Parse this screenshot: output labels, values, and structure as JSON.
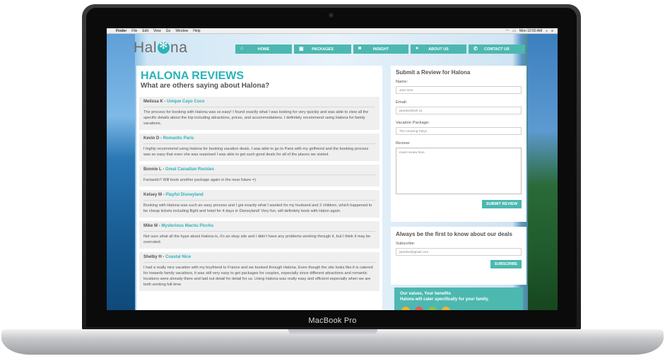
{
  "device": {
    "model_label": "MacBook Pro"
  },
  "menubar": {
    "apple": "",
    "items": [
      "Finder",
      "File",
      "Edit",
      "View",
      "Go",
      "Window",
      "Help"
    ],
    "clock": "Mon 10:50 AM"
  },
  "site": {
    "logo": {
      "left": "Hal",
      "right": "na"
    },
    "nav": [
      {
        "label": "HOME",
        "icon": "home-icon",
        "glyph": "⌂"
      },
      {
        "label": "PACKAGES",
        "icon": "suitcase-icon",
        "glyph": "▣"
      },
      {
        "label": "INSIGHT",
        "icon": "camera-icon",
        "glyph": "◙"
      },
      {
        "label": "ABOUT US",
        "icon": "person-icon",
        "glyph": "●"
      },
      {
        "label": "CONTACT US",
        "icon": "phone-icon",
        "glyph": "✆"
      }
    ]
  },
  "reviews": {
    "title": "HALONA REVIEWS",
    "subtitle": "What are others saying about Halona?",
    "items": [
      {
        "author": "Melissa K",
        "package": "Unique Cayo Coco",
        "text": "The process for booking with Halona was so easy! I found exactly what I was looking for very quickly and was able to view all the specific details about the trip including attractions, prices, and accommodations. I definitely recommend using Halona for family vacations."
      },
      {
        "author": "Kevin D",
        "package": "Romantic Paris",
        "text": "I highly recommend using Halona for booking vacation deals. I was able to go to Paris with my girlfriend and the booking process was so easy that even she was surprised I was able to get such good deals for all of the places we visited."
      },
      {
        "author": "Bonnie L",
        "package": "Great Canadian Rockies",
        "text": "Fantastic!! Will book another package again in the near future =)"
      },
      {
        "author": "Kelsey M",
        "package": "Playful Disneyland",
        "text": "Booking with Halona was such an easy process and I got exactly what I wanted for my husband and 2 children, which happened to be cheap tickets including flight and hotel for 4 days in Disneyland! Very fun, will definitely book with Halon again."
      },
      {
        "author": "Mike M",
        "package": "Mysterious Machu Picchu",
        "text": "Not sure what all the hype about Halona is, it's an okay site and I didn't have any problems working through it, but I think it may be overrated."
      },
      {
        "author": "Shelby H",
        "package": "Coastal Nice",
        "text": "I had a really nice vacation with my boyfriend to France and we booked through Halona. Even though the site looks like it is catered for towards family vacations, it was still very easy to get packages for couples, especially since different attractions and romantic locations were already there and laid out detail for detail for us. Using Halona was really easy and efficient especially when we are both working full-time."
      }
    ]
  },
  "submit_form": {
    "title": "Submit a Review for Halona",
    "name_label": "Name:",
    "name_placeholder": "Jane Doe",
    "email_label": "Email:",
    "email_placeholder": "janedoe@wh.ca",
    "package_label": "Vacation Package:",
    "package_placeholder": "The Amazing Tokyo",
    "review_label": "Review:",
    "review_placeholder": "Insert review here",
    "button": "SUBMIT REVIEW"
  },
  "subscribe_form": {
    "title": "Always be the first to know about our deals",
    "label": "Subscribe:",
    "placeholder": "janedoe@gmail.com",
    "button": "SUBSCRIBE"
  },
  "promo": {
    "line1": "Our values, Your benefits",
    "line2": "Halona will cater specifically for your family."
  },
  "colors": {
    "accent": "#2bb3b8",
    "nav": "#4cb8b0"
  }
}
